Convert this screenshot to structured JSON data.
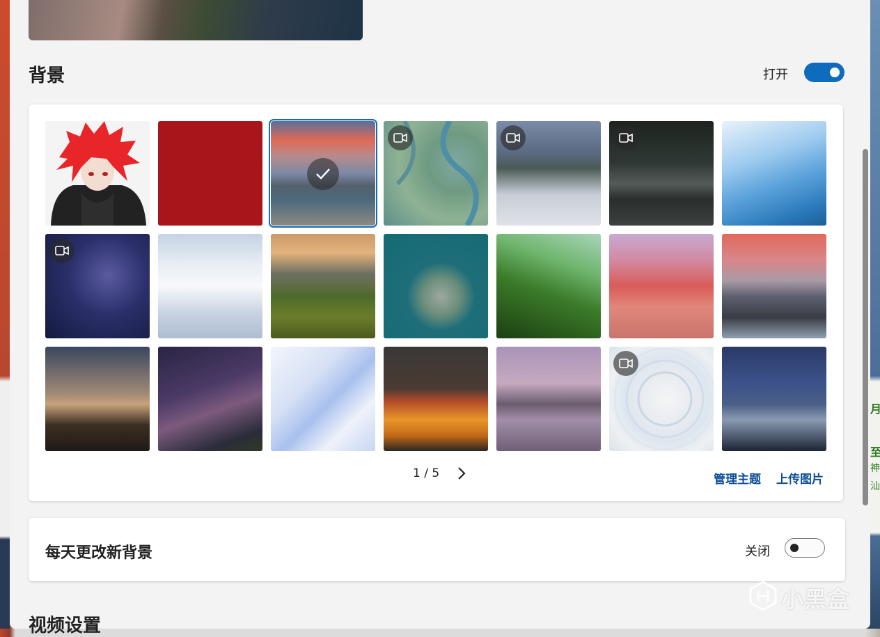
{
  "background_section": {
    "title": "背景",
    "toggle_label": "打开",
    "toggle_state": "on"
  },
  "gallery": {
    "pager": "1 / 5",
    "manage_label": "管理主题",
    "upload_label": "上传图片",
    "tiles": [
      {
        "name": "tile-anime-avatar",
        "video": false,
        "selected": false
      },
      {
        "name": "tile-red-solid",
        "video": false,
        "selected": false
      },
      {
        "name": "tile-sunset-coast",
        "video": false,
        "selected": true
      },
      {
        "name": "tile-river-aerial",
        "video": true,
        "selected": false
      },
      {
        "name": "tile-misty-mountains",
        "video": true,
        "selected": false
      },
      {
        "name": "tile-city-rooftop",
        "video": true,
        "selected": false
      },
      {
        "name": "tile-glacier",
        "video": false,
        "selected": false
      },
      {
        "name": "tile-starry-sky",
        "video": true,
        "selected": false
      },
      {
        "name": "tile-white-dunes",
        "video": false,
        "selected": false
      },
      {
        "name": "tile-green-hills",
        "video": false,
        "selected": false
      },
      {
        "name": "tile-island-aerial",
        "video": false,
        "selected": false
      },
      {
        "name": "tile-rice-terraces",
        "video": false,
        "selected": false
      },
      {
        "name": "tile-rainbow-mountains",
        "video": false,
        "selected": false
      },
      {
        "name": "tile-sunset-islands",
        "video": false,
        "selected": false
      },
      {
        "name": "tile-milky-way-canyon",
        "video": false,
        "selected": false
      },
      {
        "name": "tile-purple-galaxy",
        "video": false,
        "selected": false
      },
      {
        "name": "tile-abstract-white",
        "video": false,
        "selected": false
      },
      {
        "name": "tile-orange-dunes",
        "video": false,
        "selected": false
      },
      {
        "name": "tile-purple-lake",
        "video": false,
        "selected": false
      },
      {
        "name": "tile-white-circles",
        "video": true,
        "selected": false
      },
      {
        "name": "tile-snowy-peak-night",
        "video": false,
        "selected": false
      }
    ]
  },
  "daily_section": {
    "title": "每天更改新背景",
    "toggle_label": "关闭",
    "toggle_state": "off"
  },
  "next_section": {
    "title": "视频设置"
  },
  "side_glyphs": [
    "月",
    "至",
    "神",
    "汕"
  ],
  "watermark": "小黑盒",
  "colors": {
    "accent": "#0f6cbd",
    "link": "#0e4f96",
    "panel_bg": "#f3f3f3"
  }
}
